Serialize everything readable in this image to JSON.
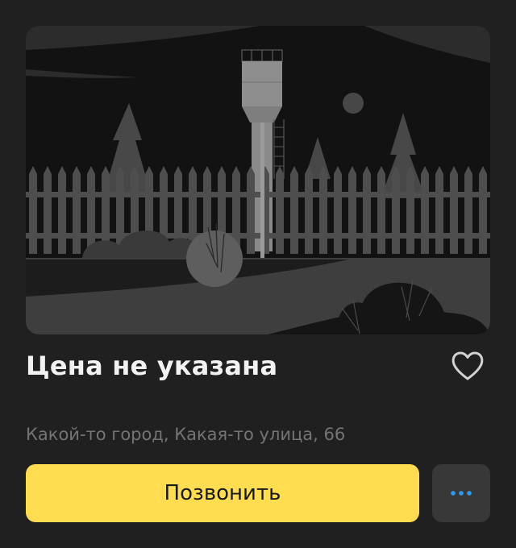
{
  "listing": {
    "price": "Цена не указана",
    "address": "Какой-то город, Какая-то улица, 66"
  },
  "actions": {
    "call_label": "Позвонить",
    "favorite_icon": "heart-outline-icon",
    "more_icon": "ellipsis-icon"
  },
  "colors": {
    "background": "#202020",
    "accent": "#FFDC50",
    "more_dots": "#2D9CF0"
  },
  "photo": {
    "type": "placeholder-illustration",
    "subject": "village fence with water tower at night"
  }
}
